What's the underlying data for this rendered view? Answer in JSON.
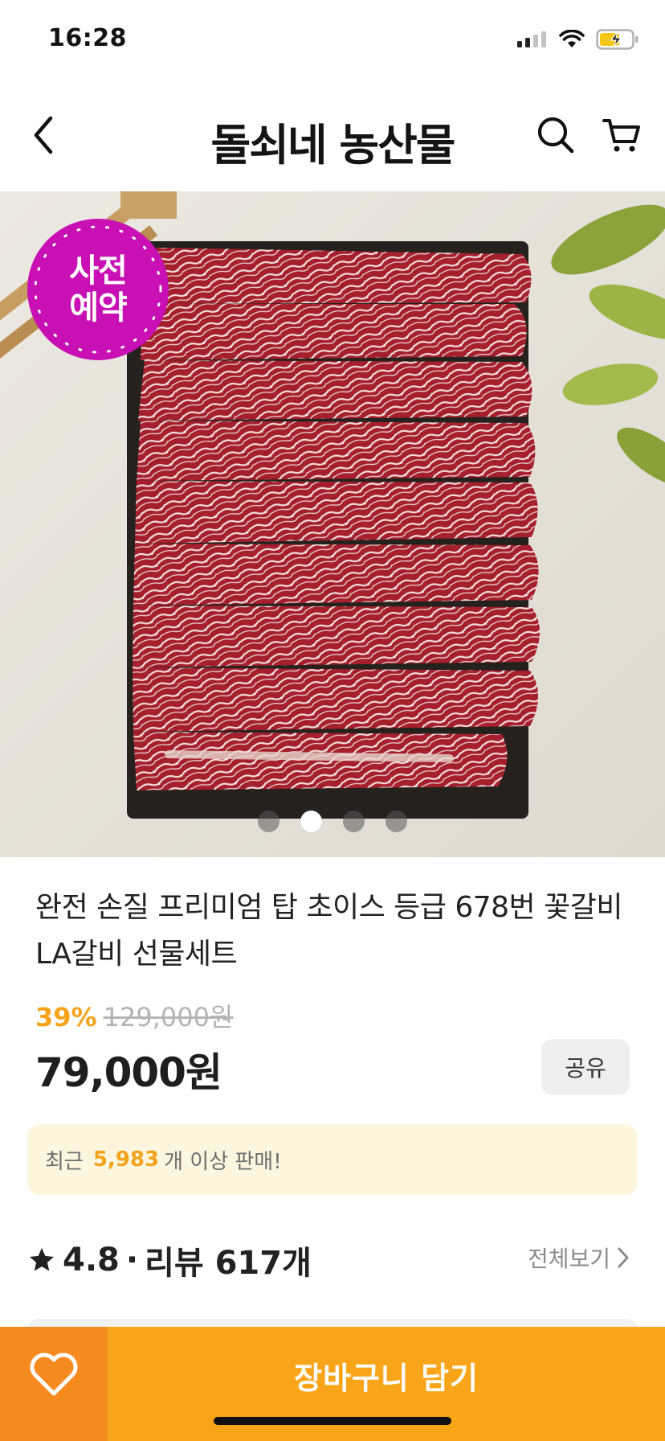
{
  "status_bar": {
    "time": "16:28"
  },
  "header": {
    "title": "돌쇠네 농산물"
  },
  "image": {
    "badge_lines": [
      "사전",
      "예약"
    ],
    "page_count": 4,
    "active_page": 1
  },
  "product": {
    "title": "완전 손질 프리미엄 탑 초이스 등급 678번 꽃갈비 LA갈비 선물세트",
    "discount_rate": "39%",
    "original_price": "129,000원",
    "sale_price": "79,000원",
    "share_label": "공유"
  },
  "sales": {
    "prefix": "최근",
    "count": "5,983",
    "suffix": "개 이상 판매!"
  },
  "rating": {
    "score": "4.8",
    "separator": "·",
    "review_label": "리뷰 617개",
    "view_all_label": "전체보기"
  },
  "bottom": {
    "add_to_cart_label": "장바구니 담기"
  },
  "colors": {
    "accent": "#f9a51a",
    "accent_dark": "#f58a1e",
    "badge": "#c810b4",
    "discount": "#f7a21b"
  },
  "icons": [
    "back-icon",
    "search-icon",
    "cart-icon",
    "heart-icon",
    "star-icon",
    "chevron-right-icon",
    "signal-icon",
    "wifi-icon",
    "battery-icon"
  ]
}
